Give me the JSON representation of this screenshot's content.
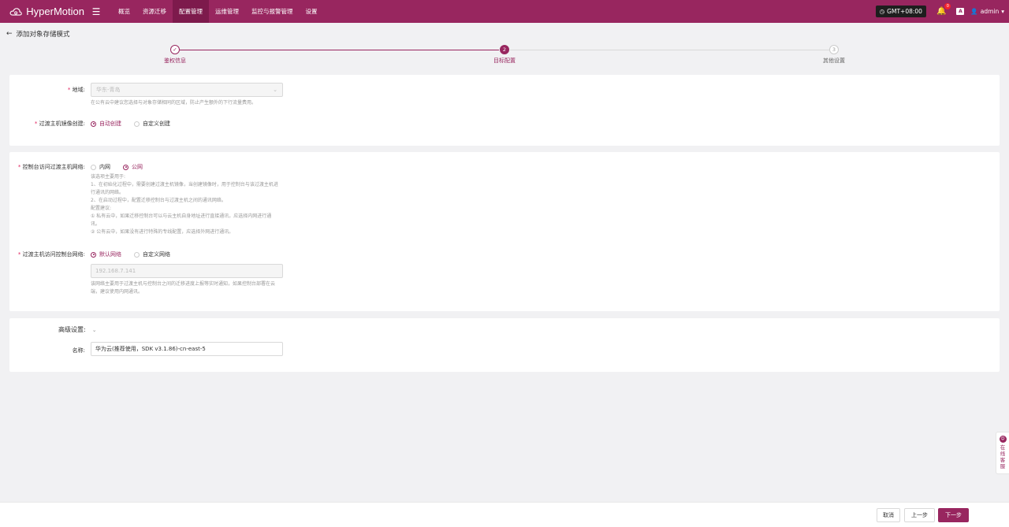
{
  "topbar": {
    "brand": "HyperMotion",
    "nav": [
      "概览",
      "资源迁移",
      "配置管理",
      "运维管理",
      "监控与报警管理",
      "设置"
    ],
    "active_index": 2,
    "timezone": "GMT+08:00",
    "notification_count": "0",
    "lang_icon": "A",
    "user": "admin"
  },
  "header": {
    "title": "添加对象存储模式"
  },
  "steps": [
    {
      "label": "鉴权信息",
      "status": "done",
      "marker": ""
    },
    {
      "label": "目标配置",
      "status": "current",
      "marker": "2"
    },
    {
      "label": "其他设置",
      "status": "pending",
      "marker": "3"
    }
  ],
  "card1": {
    "region_label": "地域:",
    "region_value": "华东-青岛",
    "region_hint": "在公有云中建议您选择与对象存储相同的区域，防止产生额外的下行流量费用。",
    "image_label": "过渡主机镜像创建:",
    "image_options": [
      "自动创建",
      "自定义创建"
    ]
  },
  "card2": {
    "console_label": "控制台访问过渡主机网络:",
    "console_options": [
      "内网",
      "公网"
    ],
    "console_hint": [
      "该选项主要用于:",
      "1、在初始化过程中，需要创建过渡主机镜像，当创建镜像时，用于控制台与该过渡主机进",
      "行通讯的网络。",
      "2、在启动过程中，配置迁移控制台与过渡主机之间的通讯网络。",
      "配置建议:",
      "① 私有云中，如果迁移控制台可以与云主机自身地址进行直接通讯，应选择内网进行通",
      "讯。",
      "② 公有云中，如果没有进行特殊的专线配置，应选择外网进行通讯。"
    ],
    "host_label": "过渡主机访问控制台网络:",
    "host_options": [
      "默认网络",
      "自定义网络"
    ],
    "host_ip": "192.168.7.141",
    "host_hint": [
      "该网络主要用于过渡主机与控制台之间的迁移进度上报等实时通知，如果控制台部署在云",
      "端，建议使用内网通讯。"
    ]
  },
  "card3": {
    "advanced_label": "高级设置:",
    "name_label": "名称:",
    "name_value": "华为云(推荐使用，SDK v3.1.86)-cn-east-5"
  },
  "footer": {
    "cancel": "取消",
    "prev": "上一步",
    "next": "下一步"
  },
  "side_service": "在线客服",
  "colors": {
    "brand": "#98265f",
    "active_nav": "#7d1a4c",
    "page_bg": "#f1f1f3"
  }
}
